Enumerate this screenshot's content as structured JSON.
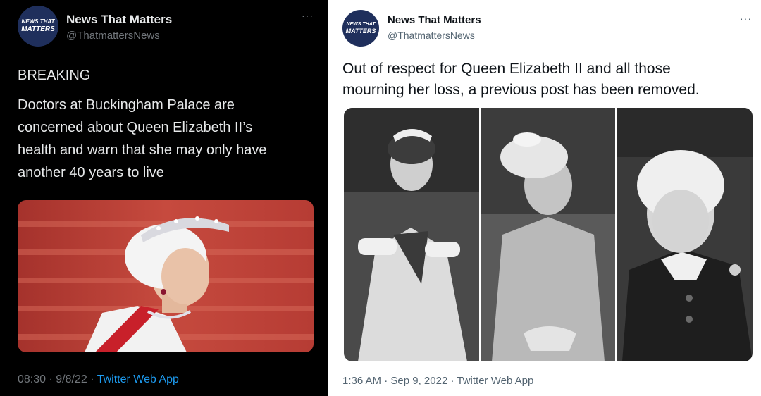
{
  "left_tweet": {
    "account": {
      "avatar_line1": "NEWS THAT",
      "avatar_line2": "MATTERS",
      "name": "News That Matters",
      "handle": "@ThatmattersNews"
    },
    "more": "···",
    "headline": "BREAKING",
    "body_lines": [
      "Doctors at Buckingham Palace are",
      "concerned about Queen Elizabeth II’s",
      "health and warn that she may only have",
      "another 40 years to live"
    ],
    "time": "08:30",
    "date": "9/8/22",
    "separator": "·",
    "client": "Twitter Web App"
  },
  "right_tweet": {
    "account": {
      "avatar_line1": "NEWS THAT",
      "avatar_line2": "MATTERS",
      "name": "News That Matters",
      "handle": "@ThatmattersNews"
    },
    "more": "···",
    "body_lines": [
      "Out of respect for Queen Elizabeth II and all those",
      "mourning her loss, a previous post has been removed."
    ],
    "time": "1:36 AM",
    "date": "Sep 9, 2022",
    "separator": "·",
    "client": "Twitter Web App"
  },
  "colors": {
    "dark_bg": "#000000",
    "link_blue": "#1d9bf0",
    "avatar_navy": "#1f2f5c"
  }
}
